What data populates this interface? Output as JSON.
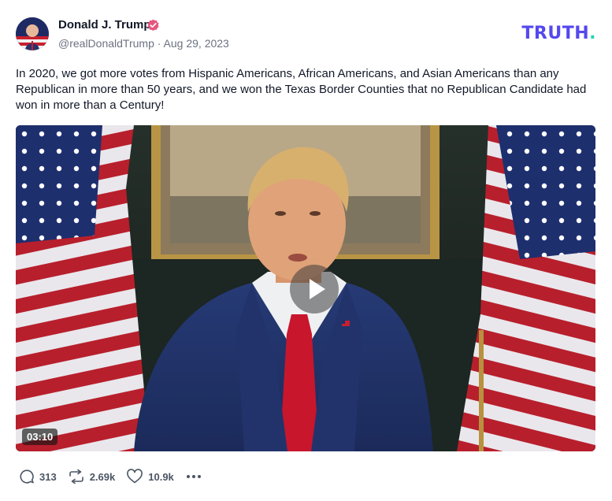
{
  "author": {
    "name": "Donald J. Trump",
    "handle": "@realDonaldTrump",
    "separator": "·",
    "date": "Aug 29, 2023",
    "verified": true
  },
  "brand": {
    "logo_text": "TRUTH",
    "logo_dot": ".",
    "primary_color": "#5448ee",
    "accent_color": "#1fd7b0"
  },
  "post": {
    "text": "In 2020, we got more votes from Hispanic Americans, African Americans, and Asian Americans than any Republican in more than 50 years, and we won the Texas Border Counties that no Republican Candidate had won in more than a Century!"
  },
  "video": {
    "duration": "03:10",
    "play_icon": "play-icon"
  },
  "actions": {
    "replies": "313",
    "retruths": "2.69k",
    "likes": "10.9k",
    "reply_icon": "reply-bubble-icon",
    "retruth_icon": "retruth-arrows-icon",
    "like_icon": "heart-icon",
    "more_icon": "more-dots-icon"
  }
}
